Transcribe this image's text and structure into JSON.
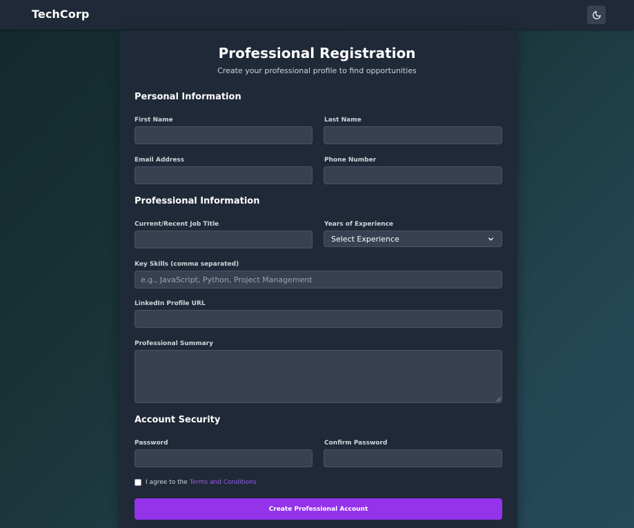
{
  "navbar": {
    "brand": "TechCorp",
    "theme_icon": "moon-icon"
  },
  "header": {
    "title": "Professional Registration",
    "subtitle": "Create your professional profile to find opportunities"
  },
  "sections": {
    "personal": "Personal Information",
    "professional": "Professional Information",
    "security": "Account Security"
  },
  "fields": {
    "first_name": {
      "label": "First Name",
      "value": ""
    },
    "last_name": {
      "label": "Last Name",
      "value": ""
    },
    "email": {
      "label": "Email Address",
      "value": ""
    },
    "phone": {
      "label": "Phone Number",
      "value": ""
    },
    "job_title": {
      "label": "Current/Recent Job Title",
      "value": ""
    },
    "experience": {
      "label": "Years of Experience",
      "selected": "Select Experience"
    },
    "skills": {
      "label": "Key Skills (comma separated)",
      "value": "",
      "placeholder": "e.g., JavaScript, Python, Project Management"
    },
    "linkedin": {
      "label": "LinkedIn Profile URL",
      "value": ""
    },
    "summary": {
      "label": "Professional Summary",
      "value": ""
    },
    "password": {
      "label": "Password",
      "value": ""
    },
    "confirm_password": {
      "label": "Confirm Password",
      "value": ""
    }
  },
  "terms": {
    "prefix": "I agree to the ",
    "link": "Terms and Conditions",
    "checked": false
  },
  "submit": {
    "label": "Create Professional Account"
  },
  "colors": {
    "accent": "#9333ea",
    "link": "#9b5cf0",
    "card": "#1f2937",
    "input": "#374151"
  }
}
